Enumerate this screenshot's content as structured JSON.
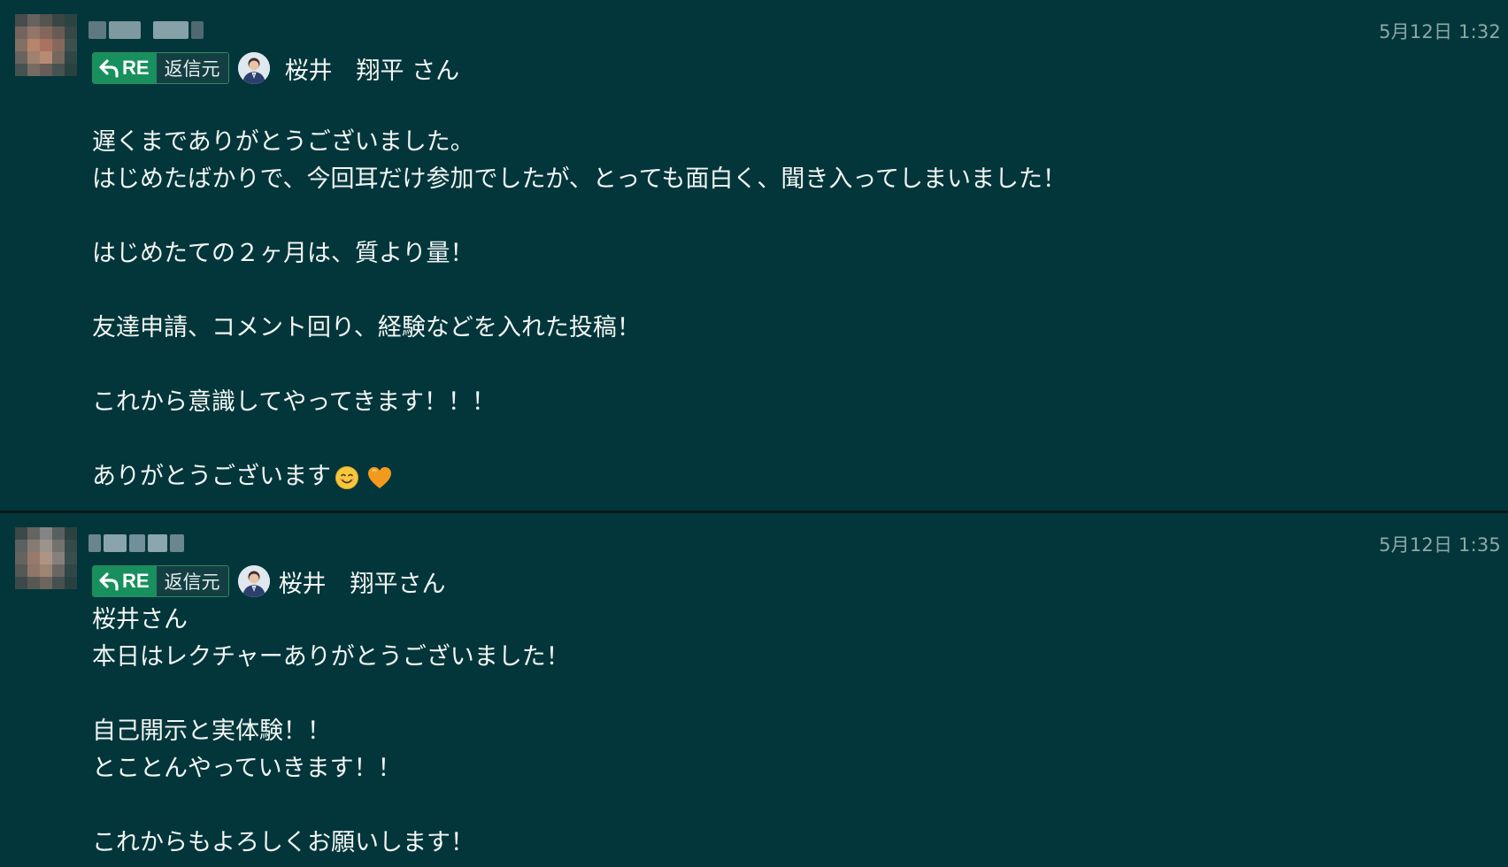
{
  "messages": [
    {
      "timestamp": "5月12日 1:32",
      "reply_badge": {
        "re_label": "RE",
        "source_label": "返信元"
      },
      "reply_to_name": "桜井　翔平 さん",
      "body_lines": [
        "遅くまでありがとうございました。",
        "はじめたばかりで、今回耳だけ参加でしたが、とっても面白く、聞き入ってしまいました！",
        "",
        "はじめたての２ヶ月は、質より量！",
        "",
        "友達申請、コメント回り、経験などを入れた投稿！",
        "",
        "これから意識してやってきます！！！",
        "",
        "ありがとうございます"
      ],
      "emojis": [
        "smiling-face-emoji",
        "orange-heart-emoji"
      ]
    },
    {
      "timestamp": "5月12日 1:35",
      "reply_badge": {
        "re_label": "RE",
        "source_label": "返信元"
      },
      "reply_to_name": "桜井　翔平さん",
      "body_lines": [
        "桜井さん",
        "本日はレクチャーありがとうございました！",
        "",
        "自己開示と実体験！！",
        "とことんやっていきます！！",
        "",
        "これからもよろしくお願いします！"
      ],
      "emojis": []
    }
  ],
  "colors": {
    "background": "#02363a",
    "re_badge_green": "#17905e",
    "timestamp": "#8fa7a7",
    "text": "#f3f5f4"
  }
}
